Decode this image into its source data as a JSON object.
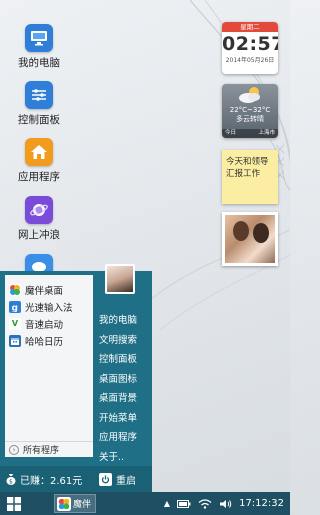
{
  "desktop": {
    "icons": [
      {
        "label": "我的电脑",
        "icon": "monitor-icon",
        "color": "#2f7fd9"
      },
      {
        "label": "控制面板",
        "icon": "sliders-icon",
        "color": "#2f7fd9"
      },
      {
        "label": "应用程序",
        "icon": "home-icon",
        "color": "#f29c1f"
      },
      {
        "label": "网上冲浪",
        "icon": "planet-icon",
        "color": "#7a4bd8"
      },
      {
        "label": "",
        "icon": "chat-icon",
        "color": "#3a8ee6"
      }
    ]
  },
  "widgets": {
    "clock": {
      "weekday": "星期二",
      "time": "02:57",
      "date": "2014年05月26日"
    },
    "weather": {
      "temp": "22°C~32°C",
      "desc": "多云转晴",
      "day": "今日",
      "city": "上海市"
    },
    "note": {
      "text": "今天和领导汇报工作"
    }
  },
  "start_menu": {
    "apps": [
      {
        "label": "魔伴桌面",
        "icon": "magic-desktop-icon",
        "color": "#e8a020"
      },
      {
        "label": "光速输入法",
        "icon": "input-method-icon",
        "color": "#2d7fd0"
      },
      {
        "label": "音速启动",
        "icon": "quick-launch-icon",
        "color": "#2a9a3a",
        "glyph": "V"
      },
      {
        "label": "哈哈日历",
        "icon": "calendar-icon",
        "color": "#2f6fb8"
      }
    ],
    "all_programs": "所有程序",
    "right_items": [
      "我的电脑",
      "文明搜索",
      "控制面板",
      "桌面图标",
      "桌面背景",
      "开始菜单",
      "应用程序",
      "关于.."
    ],
    "earned": "已赚：2.61元",
    "restart": "重启"
  },
  "taskbar": {
    "task_label": "魔伴",
    "clock": "17:12:32"
  },
  "colors": {
    "menu_bg": "#1f6f86",
    "taskbar_bg": "#1e4f63",
    "clock_header": "#e24b3b"
  }
}
